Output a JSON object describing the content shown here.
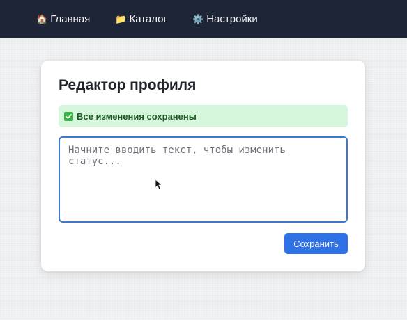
{
  "nav": {
    "items": [
      {
        "icon": "home-icon",
        "glyph": "🏠",
        "label": "Главная"
      },
      {
        "icon": "folder-icon",
        "glyph": "📁",
        "label": "Каталог"
      },
      {
        "icon": "gear-icon",
        "glyph": "⚙️",
        "label": "Настройки"
      }
    ]
  },
  "card": {
    "title": "Редактор профиля",
    "alert": {
      "icon": "check-icon",
      "text": "Все изменения сохранены",
      "color": "#1d5b27",
      "background": "#d7f7dc"
    },
    "editor": {
      "value": "",
      "placeholder": "Начните вводить текст, чтобы изменить статус..."
    },
    "save_label": "Сохранить"
  },
  "colors": {
    "nav_background": "#1e2537",
    "accent": "#2f72e6",
    "editor_border": "#3a78d1"
  }
}
